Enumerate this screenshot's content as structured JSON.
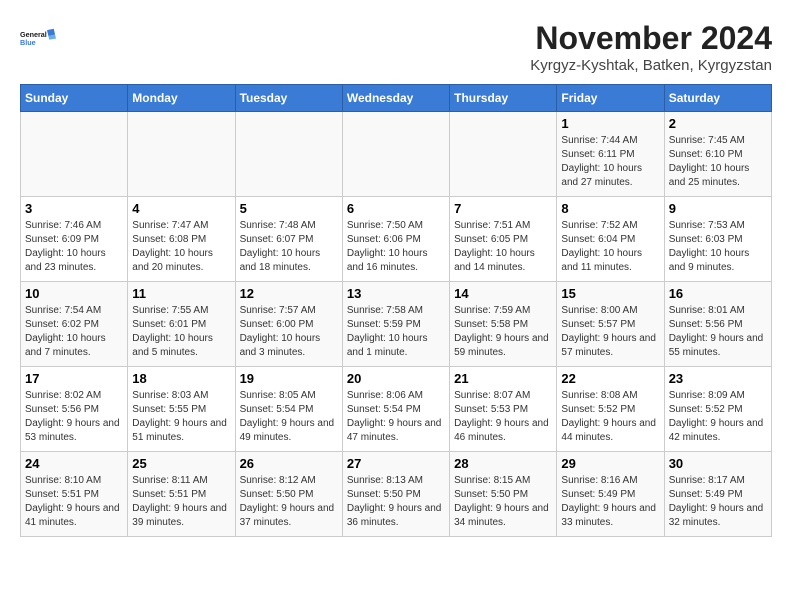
{
  "logo": {
    "line1": "General",
    "line2": "Blue"
  },
  "title": "November 2024",
  "location": "Kyrgyz-Kyshtak, Batken, Kyrgyzstan",
  "weekdays": [
    "Sunday",
    "Monday",
    "Tuesday",
    "Wednesday",
    "Thursday",
    "Friday",
    "Saturday"
  ],
  "weeks": [
    [
      {
        "day": "",
        "info": ""
      },
      {
        "day": "",
        "info": ""
      },
      {
        "day": "",
        "info": ""
      },
      {
        "day": "",
        "info": ""
      },
      {
        "day": "",
        "info": ""
      },
      {
        "day": "1",
        "info": "Sunrise: 7:44 AM\nSunset: 6:11 PM\nDaylight: 10 hours and 27 minutes."
      },
      {
        "day": "2",
        "info": "Sunrise: 7:45 AM\nSunset: 6:10 PM\nDaylight: 10 hours and 25 minutes."
      }
    ],
    [
      {
        "day": "3",
        "info": "Sunrise: 7:46 AM\nSunset: 6:09 PM\nDaylight: 10 hours and 23 minutes."
      },
      {
        "day": "4",
        "info": "Sunrise: 7:47 AM\nSunset: 6:08 PM\nDaylight: 10 hours and 20 minutes."
      },
      {
        "day": "5",
        "info": "Sunrise: 7:48 AM\nSunset: 6:07 PM\nDaylight: 10 hours and 18 minutes."
      },
      {
        "day": "6",
        "info": "Sunrise: 7:50 AM\nSunset: 6:06 PM\nDaylight: 10 hours and 16 minutes."
      },
      {
        "day": "7",
        "info": "Sunrise: 7:51 AM\nSunset: 6:05 PM\nDaylight: 10 hours and 14 minutes."
      },
      {
        "day": "8",
        "info": "Sunrise: 7:52 AM\nSunset: 6:04 PM\nDaylight: 10 hours and 11 minutes."
      },
      {
        "day": "9",
        "info": "Sunrise: 7:53 AM\nSunset: 6:03 PM\nDaylight: 10 hours and 9 minutes."
      }
    ],
    [
      {
        "day": "10",
        "info": "Sunrise: 7:54 AM\nSunset: 6:02 PM\nDaylight: 10 hours and 7 minutes."
      },
      {
        "day": "11",
        "info": "Sunrise: 7:55 AM\nSunset: 6:01 PM\nDaylight: 10 hours and 5 minutes."
      },
      {
        "day": "12",
        "info": "Sunrise: 7:57 AM\nSunset: 6:00 PM\nDaylight: 10 hours and 3 minutes."
      },
      {
        "day": "13",
        "info": "Sunrise: 7:58 AM\nSunset: 5:59 PM\nDaylight: 10 hours and 1 minute."
      },
      {
        "day": "14",
        "info": "Sunrise: 7:59 AM\nSunset: 5:58 PM\nDaylight: 9 hours and 59 minutes."
      },
      {
        "day": "15",
        "info": "Sunrise: 8:00 AM\nSunset: 5:57 PM\nDaylight: 9 hours and 57 minutes."
      },
      {
        "day": "16",
        "info": "Sunrise: 8:01 AM\nSunset: 5:56 PM\nDaylight: 9 hours and 55 minutes."
      }
    ],
    [
      {
        "day": "17",
        "info": "Sunrise: 8:02 AM\nSunset: 5:56 PM\nDaylight: 9 hours and 53 minutes."
      },
      {
        "day": "18",
        "info": "Sunrise: 8:03 AM\nSunset: 5:55 PM\nDaylight: 9 hours and 51 minutes."
      },
      {
        "day": "19",
        "info": "Sunrise: 8:05 AM\nSunset: 5:54 PM\nDaylight: 9 hours and 49 minutes."
      },
      {
        "day": "20",
        "info": "Sunrise: 8:06 AM\nSunset: 5:54 PM\nDaylight: 9 hours and 47 minutes."
      },
      {
        "day": "21",
        "info": "Sunrise: 8:07 AM\nSunset: 5:53 PM\nDaylight: 9 hours and 46 minutes."
      },
      {
        "day": "22",
        "info": "Sunrise: 8:08 AM\nSunset: 5:52 PM\nDaylight: 9 hours and 44 minutes."
      },
      {
        "day": "23",
        "info": "Sunrise: 8:09 AM\nSunset: 5:52 PM\nDaylight: 9 hours and 42 minutes."
      }
    ],
    [
      {
        "day": "24",
        "info": "Sunrise: 8:10 AM\nSunset: 5:51 PM\nDaylight: 9 hours and 41 minutes."
      },
      {
        "day": "25",
        "info": "Sunrise: 8:11 AM\nSunset: 5:51 PM\nDaylight: 9 hours and 39 minutes."
      },
      {
        "day": "26",
        "info": "Sunrise: 8:12 AM\nSunset: 5:50 PM\nDaylight: 9 hours and 37 minutes."
      },
      {
        "day": "27",
        "info": "Sunrise: 8:13 AM\nSunset: 5:50 PM\nDaylight: 9 hours and 36 minutes."
      },
      {
        "day": "28",
        "info": "Sunrise: 8:15 AM\nSunset: 5:50 PM\nDaylight: 9 hours and 34 minutes."
      },
      {
        "day": "29",
        "info": "Sunrise: 8:16 AM\nSunset: 5:49 PM\nDaylight: 9 hours and 33 minutes."
      },
      {
        "day": "30",
        "info": "Sunrise: 8:17 AM\nSunset: 5:49 PM\nDaylight: 9 hours and 32 minutes."
      }
    ]
  ]
}
